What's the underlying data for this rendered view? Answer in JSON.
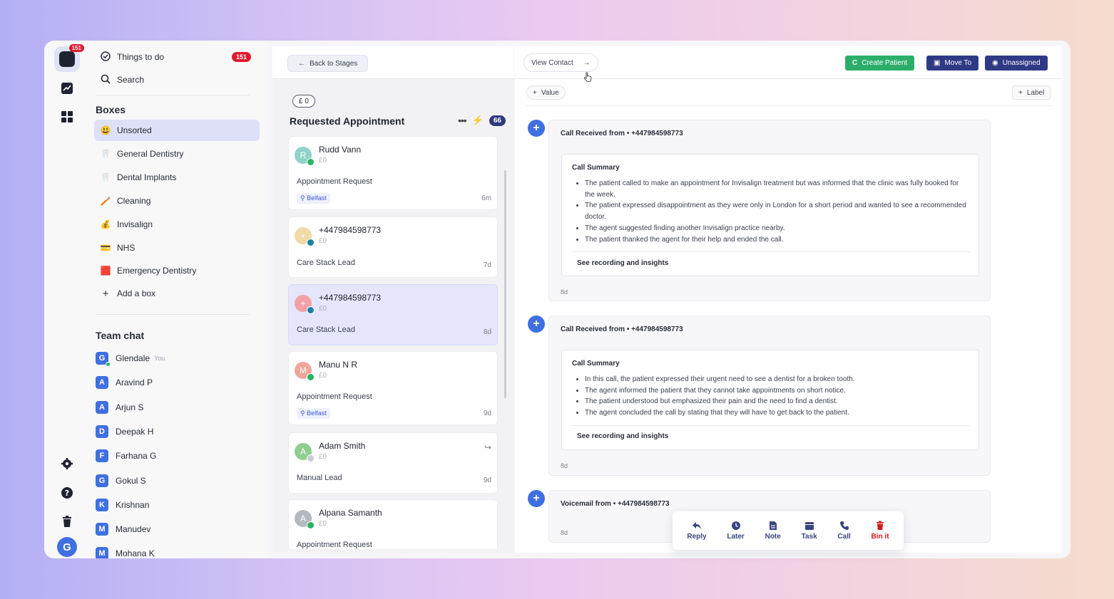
{
  "nav": {
    "things_to_do": "Things to do",
    "things_count": "151",
    "search": "Search",
    "boxes_heading": "Boxes",
    "boxes": [
      {
        "emoji": "😃",
        "label": "Unsorted",
        "active": true
      },
      {
        "emoji": "🦷",
        "label": "General Dentistry"
      },
      {
        "emoji": "🦷",
        "label": "Dental Implants"
      },
      {
        "emoji": "🪥",
        "label": "Cleaning"
      },
      {
        "emoji": "💰",
        "label": "Invisalign"
      },
      {
        "emoji": "💳",
        "label": "NHS"
      },
      {
        "emoji": "🟥",
        "label": "Emergency Dentistry"
      }
    ],
    "add_box": "Add a box",
    "team_chat_heading": "Team chat",
    "team": [
      {
        "initial": "G",
        "name": "Glendale",
        "you": "You"
      },
      {
        "initial": "A",
        "name": "Aravind P"
      },
      {
        "initial": "A",
        "name": "Arjun S"
      },
      {
        "initial": "D",
        "name": "Deepak H"
      },
      {
        "initial": "F",
        "name": "Farhana G"
      },
      {
        "initial": "G",
        "name": "Gokul S"
      },
      {
        "initial": "K",
        "name": "Krishnan"
      },
      {
        "initial": "M",
        "name": "Manudev"
      },
      {
        "initial": "M",
        "name": "Mohana K"
      }
    ]
  },
  "rail": {
    "logo_badge": "151",
    "user_initial": "G"
  },
  "column": {
    "back_label": "Back to Stages",
    "amount_tab": "£ 0",
    "title": "Requested Appointment",
    "count": "66",
    "cards": [
      {
        "initial": "R",
        "name": "Rudd Vann",
        "amount": "£0",
        "source": "Appointment Request",
        "tag": "Belfast",
        "age": "6m",
        "color": "#8fd3c9"
      },
      {
        "initial": "+",
        "name": "+447984598773",
        "amount": "£0",
        "source": "Care Stack Lead",
        "age": "7d",
        "color": "#f1d9a8"
      },
      {
        "initial": "+",
        "name": "+447984598773",
        "amount": "£0",
        "source": "Care Stack Lead",
        "age": "8d",
        "color": "#f3a0a8"
      },
      {
        "initial": "M",
        "name": "Manu N R",
        "amount": "£0",
        "source": "Appointment Request",
        "tag": "Belfast",
        "age": "9d",
        "color": "#f0a59a"
      },
      {
        "initial": "A",
        "name": "Adam Smith",
        "amount": "£0",
        "source": "Manual Lead",
        "age": "9d",
        "color": "#8fce8f"
      },
      {
        "initial": "A",
        "name": "Alpana Samanth",
        "amount": "£0",
        "source": "Appointment Request",
        "color": "#b6b8c0"
      }
    ]
  },
  "main": {
    "view_contact": "View Contact",
    "create_patient": "Create Patient",
    "move_to": "Move To",
    "unassigned": "Unassigned",
    "value_btn": "Value",
    "label_btn": "Label",
    "events": [
      {
        "head": "Call Received from • +447984598773",
        "summary_title": "Call Summary",
        "bullets": [
          "The patient called to make an appointment for Invisalign treatment but was informed that the clinic was fully booked for the week.",
          "The patient expressed disappointment as they were only in London for a short period and wanted to see a recommended doctor.",
          "The agent suggested finding another Invisalign practice nearby.",
          "The patient thanked the agent for their help and ended the call."
        ],
        "recording": "See recording and insights",
        "age": "8d"
      },
      {
        "head": "Call Received from • +447984598773",
        "summary_title": "Call Summary",
        "bullets": [
          "In this call, the patient expressed their urgent need to see a dentist for a broken tooth.",
          "The agent informed the patient that they cannot take appointments on short notice.",
          "The patient understood but emphasized their pain and the need to find a dentist.",
          "The agent concluded the call by stating that they will have to get back to the patient."
        ],
        "recording": "See recording and insights",
        "age": "8d"
      },
      {
        "head": "Voicemail from • +447984598773",
        "age": "8d"
      }
    ],
    "actions": [
      "Reply",
      "Later",
      "Note",
      "Task",
      "Call",
      "Bin it"
    ]
  }
}
